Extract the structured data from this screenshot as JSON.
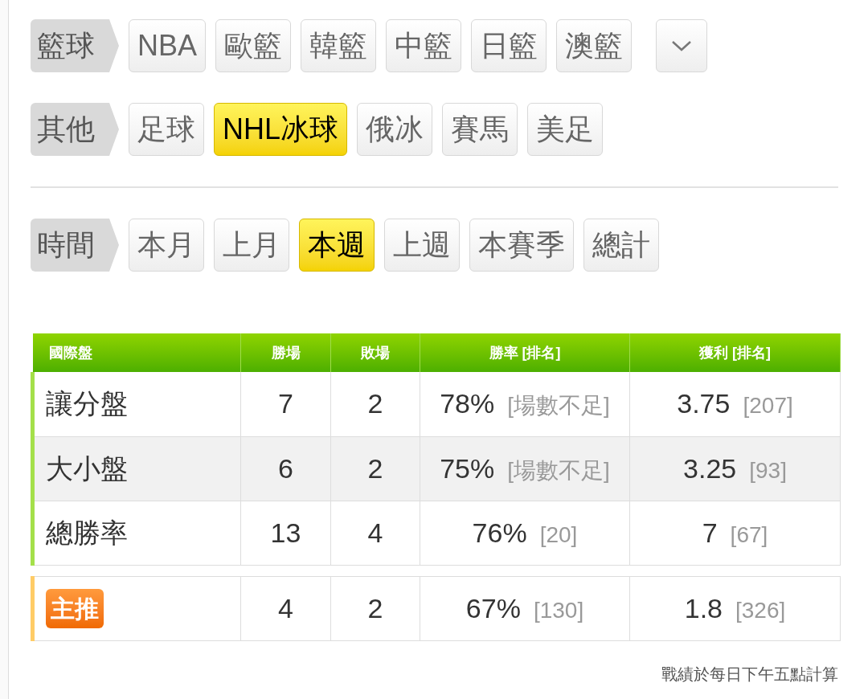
{
  "filters": [
    {
      "label": "籃球",
      "options": [
        {
          "text": "NBA",
          "selected": false
        },
        {
          "text": "歐籃",
          "selected": false
        },
        {
          "text": "韓籃",
          "selected": false
        },
        {
          "text": "中籃",
          "selected": false
        },
        {
          "text": "日籃",
          "selected": false
        },
        {
          "text": "澳籃",
          "selected": false
        }
      ],
      "expand_button": true
    },
    {
      "label": "其他",
      "options": [
        {
          "text": "足球",
          "selected": false
        },
        {
          "text": "NHL冰球",
          "selected": true
        },
        {
          "text": "俄冰",
          "selected": false
        },
        {
          "text": "賽馬",
          "selected": false
        },
        {
          "text": "美足",
          "selected": false
        }
      ],
      "expand_button": false
    },
    {
      "label": "時間",
      "options": [
        {
          "text": "本月",
          "selected": false
        },
        {
          "text": "上月",
          "selected": false
        },
        {
          "text": "本週",
          "selected": true
        },
        {
          "text": "上週",
          "selected": false
        },
        {
          "text": "本賽季",
          "selected": false
        },
        {
          "text": "總計",
          "selected": false
        }
      ],
      "expand_button": false
    }
  ],
  "table": {
    "columns": [
      "國際盤",
      "勝場",
      "敗場",
      "勝率 [排名]",
      "獲利 [排名]"
    ],
    "rows": [
      {
        "kind": "normal",
        "label": "讓分盤",
        "wins": "7",
        "losses": "2",
        "win_rate": "78%",
        "win_rate_rank": "[場數不足]",
        "profit": "3.75",
        "profit_rank": "[207]"
      },
      {
        "kind": "normal",
        "label": "大小盤",
        "wins": "6",
        "losses": "2",
        "win_rate": "75%",
        "win_rate_rank": "[場數不足]",
        "profit": "3.25",
        "profit_rank": "[93]"
      },
      {
        "kind": "normal",
        "label": "總勝率",
        "wins": "13",
        "losses": "4",
        "win_rate": "76%",
        "win_rate_rank": "[20]",
        "profit": "7",
        "profit_rank": "[67]"
      },
      {
        "kind": "featured",
        "label": "主推",
        "wins": "4",
        "losses": "2",
        "win_rate": "67%",
        "win_rate_rank": "[130]",
        "profit": "1.8",
        "profit_rank": "[326]"
      }
    ]
  },
  "footnote": "戰績於每日下午五點計算"
}
